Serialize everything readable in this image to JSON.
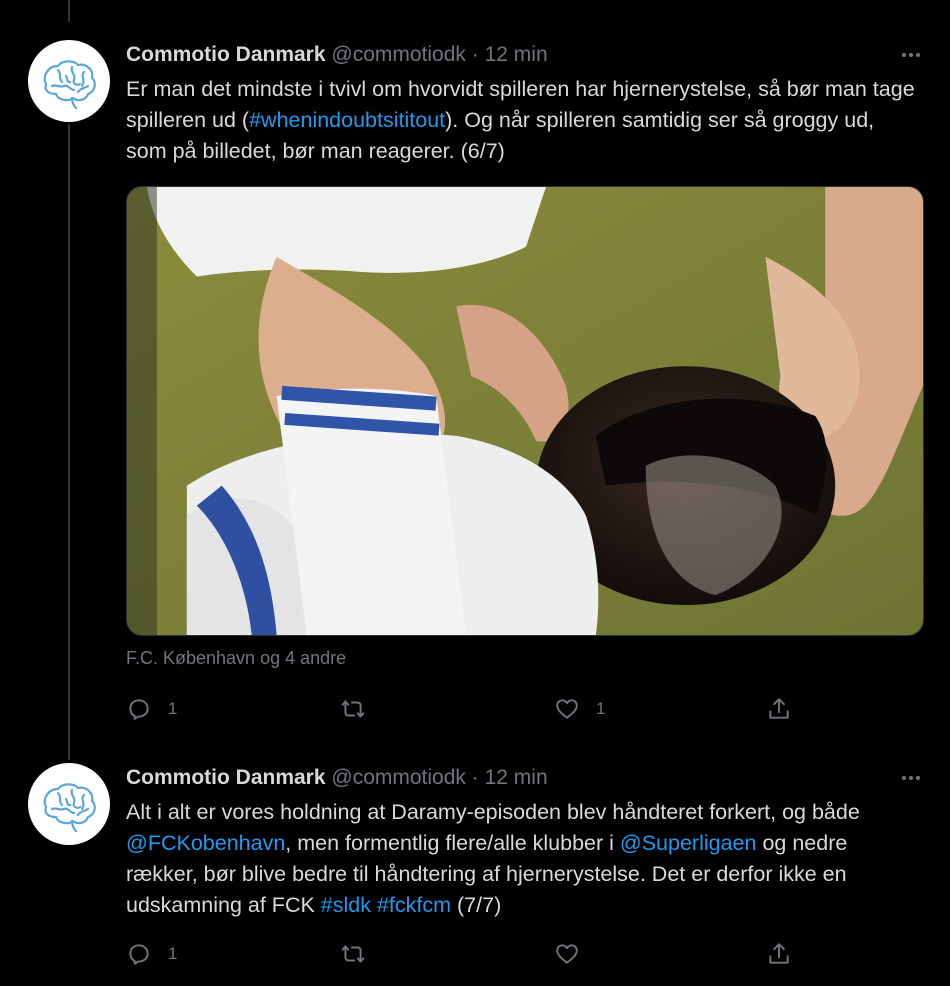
{
  "tweets": [
    {
      "name": "Commotio Danmark",
      "handle": "@commotiodk",
      "separator": "·",
      "time": "12 min",
      "text": {
        "part1": "Er man det mindste i tvivl om hvorvidt spilleren har hjernerystelse, så bør man tage spilleren ud (",
        "hashtag": "#whenindoubtsititout",
        "part2": "). Og når spilleren samtidig ser så groggy ud, som på billedet, bør man reagerer. (6/7)"
      },
      "tagged": "F.C. København og 4 andre",
      "reply_count": "1",
      "retweet_count": "",
      "like_count": "1"
    },
    {
      "name": "Commotio Danmark",
      "handle": "@commotiodk",
      "separator": "·",
      "time": "12 min",
      "text": {
        "part1": "Alt i alt er vores holdning at Daramy-episoden blev håndteret forkert, og både ",
        "mention1": "@FCKobenhavn",
        "part2": ", men formentlig flere/alle klubber i ",
        "mention2": "@Superligaen",
        "part3": " og nedre rækker, bør blive bedre til håndtering af hjernerystelse. Det er derfor ikke en udskamning af FCK ",
        "hashtag1": "#sldk",
        "space": " ",
        "hashtag2": "#fckfcm",
        "part4": " (7/7)"
      },
      "reply_count": "1",
      "retweet_count": "",
      "like_count": ""
    }
  ],
  "icons": {
    "more": "more-horizontal-icon",
    "reply": "reply-icon",
    "retweet": "retweet-icon",
    "like": "heart-icon",
    "share": "share-icon",
    "avatar": "brain-logo"
  },
  "colors": {
    "background": "#000000",
    "text": "#d9d9d9",
    "secondary": "#6e767d",
    "link": "#1d9bf0",
    "divider": "#2f3336"
  }
}
